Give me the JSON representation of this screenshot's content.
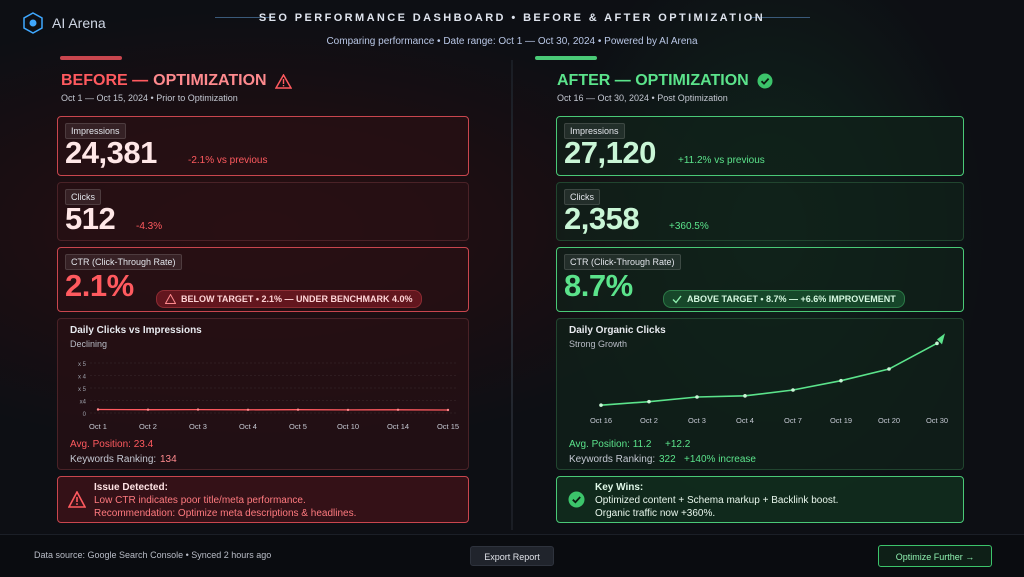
{
  "header": {
    "brand": "AI Arena",
    "title": "SEO PERFORMANCE DASHBOARD  •  BEFORE & AFTER OPTIMIZATION",
    "subtitle": "Comparing performance  •  Date range: Oct 1 — Oct 30, 2024  •  Powered by AI Arena"
  },
  "before": {
    "title_a": "BEFORE —",
    "title_b": "OPTIMIZATION",
    "dates": "Oct 1 — Oct 15, 2024  •  Prior to Optimization",
    "impressions": {
      "label": "Impressions",
      "value": "24,381",
      "delta": "-2.1% vs previous"
    },
    "clicks": {
      "label": "Clicks",
      "value": "512",
      "delta": "-4.3%"
    },
    "ctr": {
      "label": "CTR (Click-Through Rate)",
      "value": "2.1%",
      "badge": "BELOW TARGET  •  2.1% — UNDER BENCHMARK 4.0%"
    },
    "chart": {
      "title": "Daily Clicks vs Impressions",
      "sub": "Declining",
      "yticks": [
        "x 5",
        "x 4",
        "x 5",
        "x4",
        "0"
      ],
      "xticks": [
        "Oct 1",
        "Oct 2",
        "Oct 3",
        "Oct 4",
        "Oct 5",
        "Oct 10",
        "Oct 14",
        "Oct 15"
      ]
    },
    "avg_position": "Avg. Position: 23.4",
    "keywords_label": "Keywords Ranking:",
    "keywords_value": "134",
    "issue": {
      "title": "Issue Detected:",
      "line1": "Low CTR indicates poor title/meta performance.",
      "line2": "Recommendation: Optimize meta descriptions & headlines."
    }
  },
  "after": {
    "title": "AFTER — OPTIMIZATION",
    "dates": "Oct 16 — Oct 30, 2024  •  Post Optimization",
    "impressions": {
      "label": "Impressions",
      "value": "27,120",
      "delta": "+11.2% vs previous"
    },
    "clicks": {
      "label": "Clicks",
      "value": "2,358",
      "delta": "+360.5%"
    },
    "ctr": {
      "label": "CTR (Click-Through Rate)",
      "value": "8.7%",
      "badge": "ABOVE TARGET  •  8.7% — +6.6% IMPROVEMENT"
    },
    "chart": {
      "title": "Daily Organic Clicks",
      "sub": "Strong Growth",
      "xticks": [
        "Oct 16",
        "Oct 2",
        "Oct 3",
        "Oct 4",
        "Oct 7",
        "Oct 19",
        "Oct 20",
        "Oct 30"
      ]
    },
    "avg_position": "Avg. Position: 11.2",
    "avg_delta": "+12.2",
    "keywords_label": "Keywords Ranking:",
    "keywords_value": "322",
    "keywords_delta": "+140% increase",
    "wins": {
      "title": "Key Wins:",
      "line1": "Optimized content + Schema markup + Backlink boost.",
      "line2": "Organic traffic now +360%."
    }
  },
  "footer": {
    "source": "Data source: Google Search Console  •  Synced 2 hours ago",
    "export": "Export Report",
    "optimize": "Optimize Further →"
  },
  "colors": {
    "red": "#ff5a5f",
    "green": "#5be38b",
    "bg": "#0b0d12"
  },
  "chart_data": [
    {
      "type": "line",
      "title": "Daily Clicks vs Impressions",
      "categories": [
        "Oct 1",
        "Oct 2",
        "Oct 3",
        "Oct 4",
        "Oct 5",
        "Oct 10",
        "Oct 14",
        "Oct 15"
      ],
      "series": [
        {
          "values": [
            0.35,
            0.33,
            0.34,
            0.32,
            0.33,
            0.31,
            0.32,
            0.3
          ]
        }
      ],
      "ylim": [
        0,
        5
      ]
    },
    {
      "type": "line",
      "title": "Daily Organic Clicks",
      "categories": [
        "Oct 16",
        "Oct 2",
        "Oct 3",
        "Oct 4",
        "Oct 7",
        "Oct 19",
        "Oct 20",
        "Oct 30"
      ],
      "series": [
        {
          "values": [
            0.5,
            0.8,
            1.2,
            1.3,
            1.8,
            2.6,
            3.6,
            5.8
          ]
        }
      ],
      "ylim": [
        0,
        6
      ]
    }
  ]
}
